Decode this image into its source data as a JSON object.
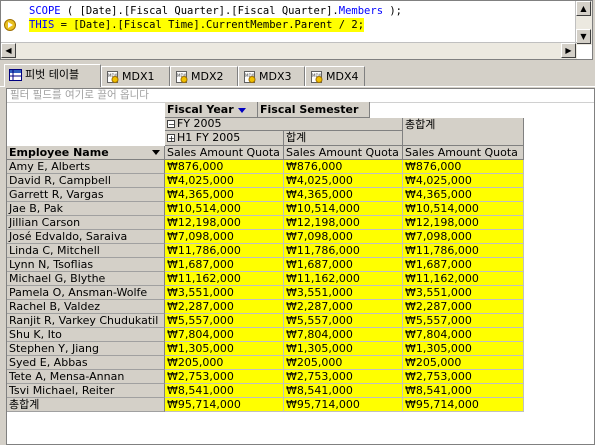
{
  "editor": {
    "line1": {
      "kw1": "SCOPE",
      "text": " ( [Date].[Fiscal Quarter].[Fiscal Quarter].",
      "kw2": "Members",
      "end": " );"
    },
    "line2": {
      "kw1": "THIS",
      "text": " = [Date].[Fiscal Time].CurrentMember.Parent / 2;"
    }
  },
  "tabs": [
    {
      "label": "피벗 테이블",
      "icon": "pivot-table-icon",
      "active": true
    },
    {
      "label": "MDX1",
      "icon": "mdx-query-icon"
    },
    {
      "label": "MDX2",
      "icon": "mdx-query-icon"
    },
    {
      "label": "MDX3",
      "icon": "mdx-query-icon"
    },
    {
      "label": "MDX4",
      "icon": "mdx-query-icon"
    }
  ],
  "pivot": {
    "filter_placeholder": "필터 필드를 여기로 끌어 옵니다",
    "column_field_1": "Fiscal Year",
    "column_field_2": "Fiscal Semester",
    "year_label": "FY 2005",
    "grand_total_col": "총합계",
    "semester_label": "H1 FY 2005",
    "subtotal_label": "합계",
    "row_field": "Employee Name",
    "measure": "Sales Amount Quota",
    "rows": [
      {
        "name": "Amy E, Alberts",
        "v": "₩876,000"
      },
      {
        "name": "David R, Campbell",
        "v": "₩4,025,000"
      },
      {
        "name": "Garrett R, Vargas",
        "v": "₩4,365,000"
      },
      {
        "name": "Jae B, Pak",
        "v": "₩10,514,000"
      },
      {
        "name": "Jillian Carson",
        "v": "₩12,198,000"
      },
      {
        "name": "José Edvaldo, Saraiva",
        "v": "₩7,098,000"
      },
      {
        "name": "Linda C, Mitchell",
        "v": "₩11,786,000"
      },
      {
        "name": "Lynn N, Tsoflias",
        "v": "₩1,687,000"
      },
      {
        "name": "Michael G, Blythe",
        "v": "₩11,162,000"
      },
      {
        "name": "Pamela O, Ansman-Wolfe",
        "v": "₩3,551,000"
      },
      {
        "name": "Rachel B, Valdez",
        "v": "₩2,287,000"
      },
      {
        "name": "Ranjit R, Varkey Chudukatil",
        "v": "₩5,557,000"
      },
      {
        "name": "Shu K, Ito",
        "v": "₩7,804,000"
      },
      {
        "name": "Stephen Y, Jiang",
        "v": "₩1,305,000"
      },
      {
        "name": "Syed E, Abbas",
        "v": "₩205,000"
      },
      {
        "name": "Tete A, Mensa-Annan",
        "v": "₩2,753,000"
      },
      {
        "name": "Tsvi Michael, Reiter",
        "v": "₩8,541,000"
      },
      {
        "name": "총합계",
        "v": "₩95,714,000"
      }
    ]
  },
  "colors": {
    "highlight": "#ffff00",
    "keyword": "#0000ff",
    "chrome": "#d4d0c8"
  }
}
